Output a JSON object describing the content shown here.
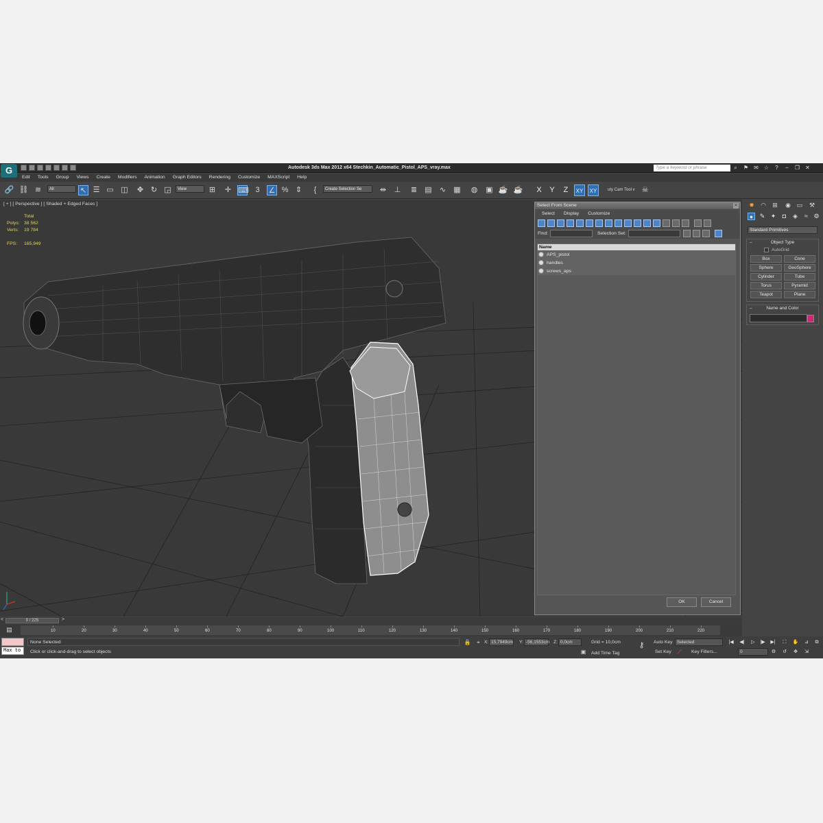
{
  "app": {
    "title": "Autodesk 3ds Max  2012 x64     Stechkin_Automatic_Pistol_APS_vray.max",
    "logo_letter": "G",
    "search_placeholder": "Type a keyword or phrase"
  },
  "menu": [
    "Edit",
    "Tools",
    "Group",
    "Views",
    "Create",
    "Modifiers",
    "Animation",
    "Graph Editors",
    "Rendering",
    "Customize",
    "MAXScript",
    "Help"
  ],
  "toolbar": {
    "filter_dropdown": "All",
    "refcoord_dropdown": "View",
    "selection_set": "Create Selection Se",
    "axis": [
      "X",
      "Y",
      "Z",
      "XY",
      "XY"
    ],
    "extra_label": "uty Cam Tool v"
  },
  "viewport": {
    "label": "[ + ] [ Perspective ] [ Shaded + Edged Faces ]",
    "stats": {
      "total_label": "Total",
      "polys_label": "Polys:",
      "polys_value": "38 562",
      "verts_label": "Verts:",
      "verts_value": "19 784",
      "fps_label": "FPS:",
      "fps_value": "165,949"
    }
  },
  "dialog": {
    "title": "Select From Scene",
    "menu": [
      "Select",
      "Display",
      "Customize"
    ],
    "find_label": "Find:",
    "selection_set_label": "Selection Set:",
    "column_name": "Name",
    "rows": [
      "APS_pistol",
      "handles",
      "screws_aps"
    ],
    "ok": "OK",
    "cancel": "Cancel"
  },
  "command_panel": {
    "dropdown": "Standard Primitives",
    "object_type_title": "Object Type",
    "autogrid": "AutoGrid",
    "buttons": [
      "Box",
      "Cone",
      "Sphere",
      "GeoSphere",
      "Cylinder",
      "Tube",
      "Torus",
      "Pyramid",
      "Teapot",
      "Plane"
    ],
    "name_color_title": "Name and Color",
    "color": "#d4237a"
  },
  "timeline": {
    "frame": "0 / 225",
    "ticks": [
      "10",
      "20",
      "30",
      "40",
      "50",
      "60",
      "70",
      "80",
      "90",
      "100",
      "110",
      "120",
      "130",
      "140",
      "150",
      "160",
      "170",
      "180",
      "190",
      "200",
      "210",
      "220"
    ]
  },
  "status": {
    "maxscript": "Max to",
    "selection": "None Selected",
    "prompt": "Click or click-and-drag to select objects",
    "x_label": "X:",
    "x_value": "15,7949cm",
    "y_label": "Y:",
    "y_value": "-56,1553cm",
    "z_label": "Z:",
    "z_value": "0,0cm",
    "grid": "Grid = 10,0cm",
    "add_time_tag": "Add Time Tag",
    "auto_key": "Auto Key",
    "auto_key_value": "Selected",
    "set_key": "Set Key",
    "key_filters": "Key Filters...",
    "frame_value": "0"
  }
}
